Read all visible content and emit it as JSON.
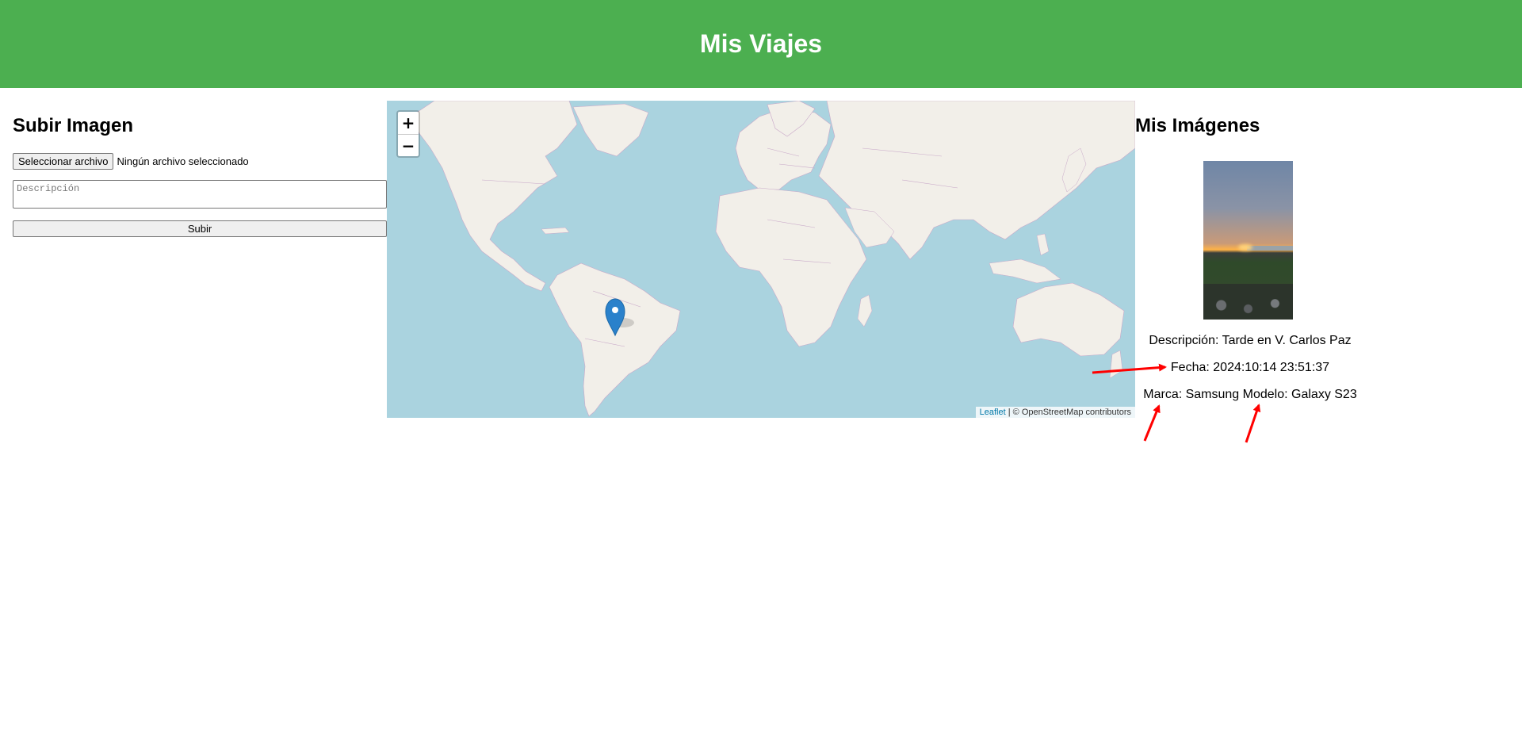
{
  "header": {
    "title": "Mis Viajes"
  },
  "upload": {
    "title": "Subir Imagen",
    "file_button_label": "Seleccionar archivo",
    "file_status": "Ningún archivo seleccionado",
    "description_placeholder": "Descripción",
    "submit_label": "Subir"
  },
  "map": {
    "zoom_in": "+",
    "zoom_out": "−",
    "attribution_link": "Leaflet",
    "attribution_sep": " | © ",
    "attribution_text": "OpenStreetMap contributors",
    "colors": {
      "water": "#aad3df",
      "land": "#f2efe9",
      "borders": "#c9a9c9",
      "marker": "#2a81cb"
    },
    "marker_icon": "map-marker-icon"
  },
  "gallery": {
    "title": "Mis Imágenes",
    "items": [
      {
        "description_label": "Descripción: ",
        "description": "Tarde en V. Carlos Paz",
        "date_label": "Fecha: ",
        "date": "2024:10:14 23:51:37",
        "brand_label": "Marca: ",
        "brand": "Samsung",
        "model_label": " Modelo: ",
        "model": "Galaxy S23"
      }
    ]
  },
  "colors": {
    "header_bg": "#4caf50",
    "annotation_arrow": "#ff0000"
  }
}
